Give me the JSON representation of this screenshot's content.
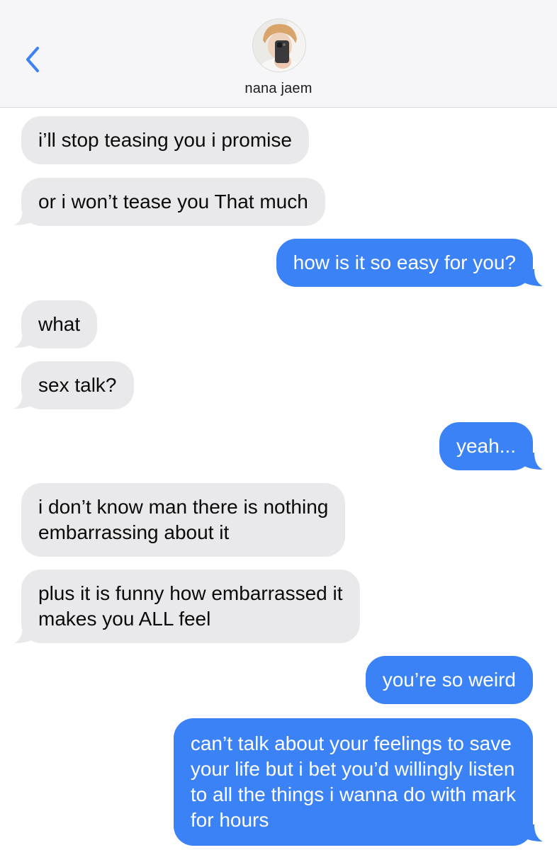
{
  "header": {
    "contact_name": "nana jaem",
    "colors": {
      "header_bg": "#f6f6f8",
      "back_chevron": "#3b82f6"
    },
    "icons": {
      "back": "chevron-left-icon",
      "avatar": "contact-avatar"
    }
  },
  "colors": {
    "incoming_bubble": "#e9e9eb",
    "outgoing_bubble": "#3b82f6",
    "incoming_text": "#0a0a0a",
    "outgoing_text": "#ffffff"
  },
  "messages": [
    {
      "direction": "incoming",
      "lines": [
        "i’ll stop teasing you i promise"
      ]
    },
    {
      "direction": "incoming",
      "lines": [
        "or i won’t tease you That much"
      ]
    },
    {
      "direction": "outgoing",
      "lines": [
        "how is it so easy for you?"
      ]
    },
    {
      "direction": "incoming",
      "lines": [
        "what"
      ]
    },
    {
      "direction": "incoming",
      "lines": [
        "sex talk?"
      ]
    },
    {
      "direction": "outgoing",
      "lines": [
        "yeah..."
      ]
    },
    {
      "direction": "incoming",
      "lines": [
        "i don’t know man there is nothing",
        "embarrassing about it"
      ]
    },
    {
      "direction": "incoming",
      "lines": [
        "plus it is funny how embarrassed it",
        "makes you ALL feel"
      ]
    },
    {
      "direction": "outgoing",
      "lines": [
        "you’re so weird"
      ]
    },
    {
      "direction": "outgoing",
      "lines": [
        "can’t talk about your feelings to save",
        "your life but i bet you’d willingly listen",
        "to all the things i wanna do with mark",
        "for hours"
      ]
    }
  ]
}
